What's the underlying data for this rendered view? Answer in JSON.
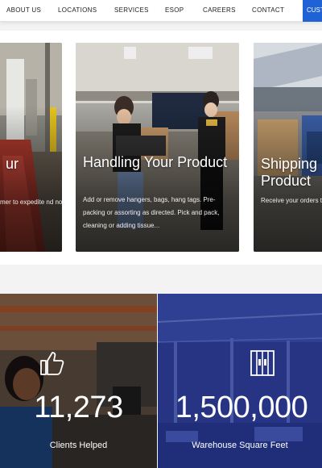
{
  "nav": {
    "items": [
      "ABOUT US",
      "LOCATIONS",
      "SERVICES",
      "ESOP",
      "CAREERS",
      "CONTACT"
    ],
    "cta": "CUST"
  },
  "cards": [
    {
      "title": "ur",
      "desc": "mer to expedite nd notify you of"
    },
    {
      "title": "Handling Your Product",
      "desc": "Add or remove hangers, bags, hang tags. Pre-packing or assorting as directed. Pick and pack, cleaning or adding tissue..."
    },
    {
      "title": "Shipping Product",
      "desc": "Receive your orders transmission. Floor l customer specificatio"
    }
  ],
  "stats": [
    {
      "value": "11,273",
      "label": "Clients Helped",
      "icon": "thumbs-up-icon"
    },
    {
      "value": "1,500,000",
      "label": "Warehouse Square Feet",
      "icon": "warehouse-icon"
    }
  ],
  "colors": {
    "accent": "#1f62d6",
    "stat_blue": "#2a3c8c"
  }
}
